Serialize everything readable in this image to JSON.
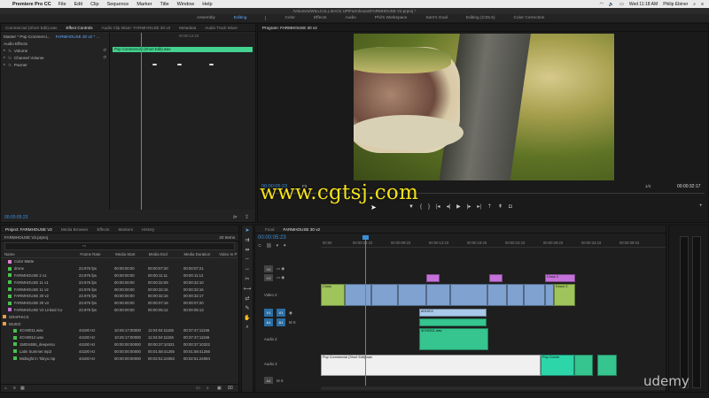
{
  "menubar": {
    "app": "Premiere Pro CC",
    "items": [
      "File",
      "Edit",
      "Clip",
      "Sequence",
      "Marker",
      "Title",
      "Window",
      "Help"
    ],
    "clock": "Wed 11:18 AM",
    "user": "Philip Ebiner"
  },
  "title": "/Volumes/WILLCALL BACK UP/Farmhouse/FARMHOUSE V2.prproj *",
  "workspaces": [
    "Assembly",
    "Editing",
    "Color",
    "Effects",
    "Audio",
    "Phil's Workspace",
    "Sam's Goal",
    "Editing (CS5.5)",
    "Color Correction"
  ],
  "effect_panel": {
    "tabs": [
      "Commercial (Short Edit).wav",
      "Effect Controls",
      "Audio Clip Mixer: FARMHOUSE 30 v2",
      "Metadata",
      "Audio Track Mixer"
    ],
    "master_label": "Master * Pop Commerci...",
    "sequence_label": "FARMHOUSE 30 v2 * ...",
    "section": "Audio Effects",
    "rows": [
      "Volume",
      "Channel Volume",
      "Panner"
    ],
    "clip_name": "Pop Commercial (Short Edit).wav",
    "ruler_tc": "00:00:14:23",
    "timecode": "00:00:05:23"
  },
  "program_panel": {
    "tab": "Program: FARMHOUSE 30 v2",
    "timecode": "00:00:05:23",
    "fit": "Fit",
    "resolution": "1/2",
    "duration": "00:00:32:17",
    "watermark": "www.cgtsj.com"
  },
  "project_panel": {
    "tabs": [
      "Project: FARMHOUSE V2",
      "Media Browser",
      "Effects",
      "Markers",
      "History"
    ],
    "file": "FARMHOUSE V2.prproj",
    "count": "20 Items",
    "columns": [
      "Name",
      "Frame Rate",
      "Media Start",
      "Media End",
      "Media Duration",
      "Video In P"
    ],
    "rows": [
      {
        "name": "Color Matte",
        "fps": "",
        "start": "",
        "end": "",
        "dur": "",
        "color": "#e07fd0",
        "indent": 1
      },
      {
        "name": "drone",
        "fps": "23.976 fps",
        "start": "00:00:00:00",
        "end": "00:00:07:20",
        "dur": "00:00:07:21",
        "color": "#49c04e",
        "indent": 1
      },
      {
        "name": "FARMHOUSE 2 v1",
        "fps": "23.976 fps",
        "start": "00:00:00:00",
        "end": "00:00:11:11",
        "dur": "00:00:11:12",
        "color": "#49c04e",
        "indent": 1
      },
      {
        "name": "FARMHOUSE 11 v1",
        "fps": "23.976 fps",
        "start": "00:00:00:00",
        "end": "00:00:32:09",
        "dur": "00:00:32:10",
        "color": "#49c04e",
        "indent": 1
      },
      {
        "name": "FARMHOUSE 11 v2",
        "fps": "23.976 fps",
        "start": "00:00:00:00",
        "end": "00:00:32:15",
        "dur": "00:00:32:16",
        "color": "#49c04e",
        "indent": 1
      },
      {
        "name": "FARMHOUSE 30 v2",
        "fps": "23.976 fps",
        "start": "00:00:00:00",
        "end": "00:00:32:16",
        "dur": "00:00:32:17",
        "color": "#49c04e",
        "indent": 1
      },
      {
        "name": "FARMHOUSE 30 v3",
        "fps": "23.976 fps",
        "start": "00:00:00:00",
        "end": "00:00:07:19",
        "dur": "00:00:07:20",
        "color": "#49c04e",
        "indent": 1
      },
      {
        "name": "FARMHOUSE V2 Linked Co",
        "fps": "23.976 fps",
        "start": "00:00:00:00",
        "end": "00:00:05:12",
        "dur": "00:00:05:13",
        "color": "#c472d9",
        "indent": 1
      },
      {
        "name": "GRAPHICS",
        "fps": "",
        "start": "",
        "end": "",
        "dur": "",
        "color": "#e3a04a",
        "indent": 0
      },
      {
        "name": "MUSIC",
        "fps": "",
        "start": "",
        "end": "",
        "dur": "",
        "color": "#e3a04a",
        "indent": 0
      },
      {
        "name": "4CH0011.wav",
        "fps": "44100 Hz",
        "start": "10:26:17:00000",
        "end": "11:04:04:11155",
        "dur": "00:37:47:11156",
        "color": "#49c04e",
        "indent": 2
      },
      {
        "name": "4CH0012.wav",
        "fps": "44100 Hz",
        "start": "10:26:17:00000",
        "end": "11:04:04:11155",
        "dur": "00:37:47:11156",
        "color": "#49c04e",
        "indent": 2
      },
      {
        "name": "150044B6_deeperso",
        "fps": "44100 Hz",
        "start": "00:00:00:00000",
        "end": "00:00:37:10321",
        "dur": "00:00:37:10322",
        "color": "#49c04e",
        "indent": 2
      },
      {
        "name": "Latin Summer.mp3",
        "fps": "44100 Hz",
        "start": "00:00:00:00000",
        "end": "00:01:58:41255",
        "dur": "00:01:58:41256",
        "color": "#49c04e",
        "indent": 2
      },
      {
        "name": "Midnight in Tokyo.mp",
        "fps": "44100 Hz",
        "start": "00:00:00:00000",
        "end": "00:02:51:24083",
        "dur": "00:02:51:24084",
        "color": "#49c04e",
        "indent": 2
      }
    ]
  },
  "tools": [
    "selection-tool",
    "track-select-tool",
    "ripple-edit-tool",
    "rolling-edit-tool",
    "rate-stretch-tool",
    "razor-tool",
    "slip-tool",
    "slide-tool",
    "pen-tool",
    "hand-tool",
    "zoom-tool"
  ],
  "timeline": {
    "tabs": [
      "Food",
      "FARMHOUSE 30 v2"
    ],
    "timecode": "00:00:05:23",
    "ruler": [
      "00:00",
      "00:00:04:23",
      "00:00:09:23",
      "00:00:14:23",
      "00:00:19:23",
      "00:00:24:23",
      "00:00:29:23",
      "00:00:34:23",
      "00:00:39:23"
    ],
    "tracks": [
      "V4",
      "V3",
      "Video 2",
      "V1",
      "A1",
      "Audio 2",
      "Audio 3",
      "A4"
    ],
    "track_targets": [
      "V1",
      "A1"
    ],
    "clips": {
      "cross": "Cross",
      "v1": "A015C0",
      "a1": "4CH0011.wav",
      "a3": "Pop Commercial (Short Edit).wav",
      "a3b": "Pop Comm",
      "cross2": "Cross 2",
      "drone": "Drone 2"
    }
  },
  "udemy": "udemy",
  "colors": {
    "accent": "#3b8fd9",
    "audio_clip": "#36c48f",
    "video_clip": "#7fa2d0",
    "watermark": "#f4e21b"
  }
}
